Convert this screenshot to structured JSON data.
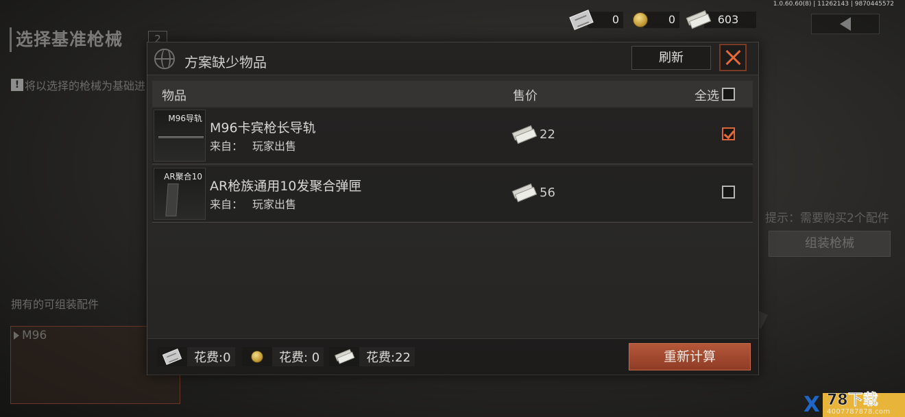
{
  "version": "1.0.60.60(8) | 11262143 | 9870445572",
  "background": {
    "title": "选择基准枪械",
    "badge": "2",
    "warning": "将以选择的枪械为基础进",
    "hint": "提示：需要购买2个配件",
    "assemble_button": "组装枪械",
    "owned_label": "拥有的可组装配件",
    "card_label": "M96"
  },
  "currency": {
    "voucher": "0",
    "coin": "0",
    "cash": "603"
  },
  "modal": {
    "title": "方案缺少物品",
    "refresh_label": "刷新",
    "columns": {
      "item": "物品",
      "price": "售价",
      "select_all": "全选"
    },
    "items": [
      {
        "thumb_label": "M96导轨",
        "name": "M96卡宾枪长导轨",
        "source_label": "来自：",
        "source": "玩家出售",
        "price": "22",
        "checked": true
      },
      {
        "thumb_label": "AR聚合10",
        "name": "AR枪族通用10发聚合弹匣",
        "source_label": "来自：",
        "source": "玩家出售",
        "price": "56",
        "checked": false
      }
    ],
    "footer": {
      "voucher_cost": "花费:0",
      "coin_cost": "花费: 0",
      "cash_cost": "花费:22",
      "recalc_label": "重新计算"
    }
  },
  "watermark": {
    "logo": "X",
    "text": "78下载",
    "url": "4007787878.com"
  },
  "colors": {
    "accent": "#e0643a",
    "button": "#a34a30",
    "panel": "#2a2927"
  }
}
